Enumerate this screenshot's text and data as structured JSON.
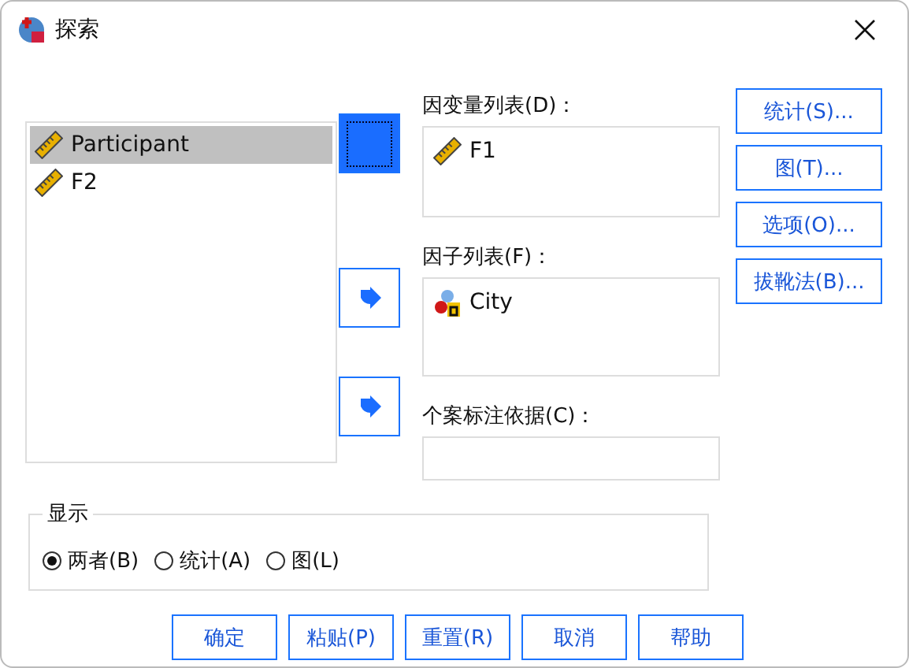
{
  "window": {
    "title": "探索"
  },
  "source_list": {
    "items": [
      {
        "name": "Participant",
        "kind": "scale",
        "selected": true
      },
      {
        "name": "F2",
        "kind": "scale",
        "selected": false
      }
    ]
  },
  "move_buttons": [
    {
      "focused": true
    },
    {
      "focused": false
    },
    {
      "focused": false
    }
  ],
  "targets": [
    {
      "label": "因变量列表(D)：",
      "items": [
        {
          "name": "F1",
          "kind": "scale"
        }
      ]
    },
    {
      "label": "因子列表(F)：",
      "items": [
        {
          "name": "City",
          "kind": "nominal"
        }
      ]
    },
    {
      "label": "个案标注依据(C)："
    }
  ],
  "side_buttons": [
    "统计(S)...",
    "图(T)...",
    "选项(O)...",
    "拔靴法(B)..."
  ],
  "display": {
    "title": "显示",
    "options": [
      {
        "label": "两者(B)",
        "selected": true
      },
      {
        "label": "统计(A)",
        "selected": false
      },
      {
        "label": "图(L)",
        "selected": false
      }
    ]
  },
  "buttons": [
    "确定",
    "粘贴(P)",
    "重置(R)",
    "取消",
    "帮助"
  ]
}
